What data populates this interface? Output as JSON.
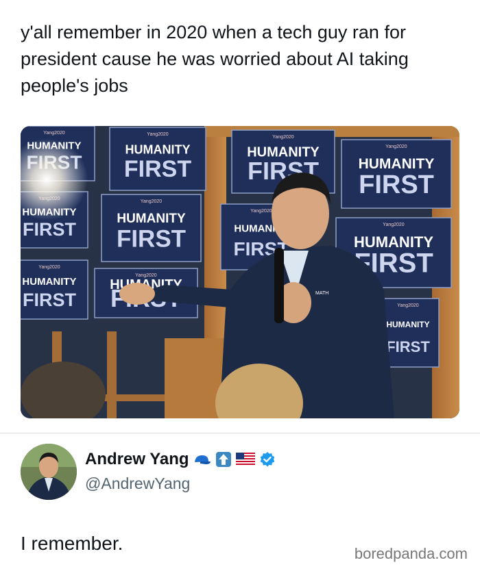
{
  "post": {
    "text": "y'all remember in 2020 when a tech guy ran for president cause he was worried about AI taking people's jobs"
  },
  "photo": {
    "signs": [
      {
        "line1": "HUMANITY",
        "line2": "FIRST"
      },
      {
        "line1": "HUMANITY",
        "line2": "FIRST"
      },
      {
        "line1": "HUMANITY",
        "line2": "FIRST"
      },
      {
        "line1": "HUMANITY",
        "line2": "FIRST"
      },
      {
        "line1": "HUMANITY",
        "line2": "FIRST"
      },
      {
        "line1": "HUMANITY",
        "line2": "FIRST"
      },
      {
        "line1": "HUMANITY",
        "line2": "FIRST"
      },
      {
        "line1": "HUMANITY",
        "line2": "FIRST"
      },
      {
        "line1": "HUMANITY",
        "line2": "FIRST"
      },
      {
        "line1": "HUMANITY",
        "line2": "FIRST"
      },
      {
        "line1": "HUMANITY",
        "line2": "FIRST"
      }
    ],
    "sign_small": "Yang2020",
    "pin_text": "MATH"
  },
  "reply": {
    "display_name": "Andrew Yang",
    "handle": "@AndrewYang",
    "text": "I remember.",
    "badges": [
      "blue-cap-emoji",
      "up-arrow-emoji",
      "us-flag-emoji",
      "verified-badge"
    ]
  },
  "watermark": "boredpanda.com",
  "colors": {
    "sign_navy": "#1f2f5a",
    "wood": "#b57a3c",
    "verified": "#1d9bf0"
  }
}
